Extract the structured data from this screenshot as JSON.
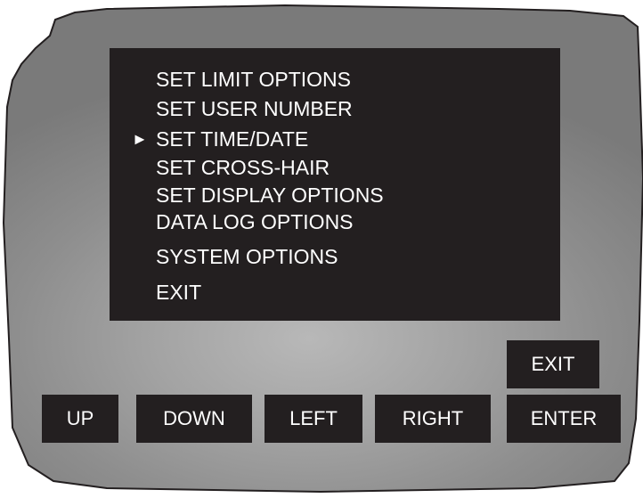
{
  "menu": {
    "items": [
      {
        "label": "SET LIMIT OPTIONS"
      },
      {
        "label": "SET USER NUMBER"
      },
      {
        "label": "SET TIME/DATE",
        "selected": true
      },
      {
        "label": "SET CROSS-HAIR"
      },
      {
        "label": "SET DISPLAY OPTIONS"
      },
      {
        "label": "DATA LOG OPTIONS"
      },
      {
        "label": "SYSTEM OPTIONS"
      },
      {
        "label": "EXIT"
      }
    ],
    "cursor_glyph": "►"
  },
  "buttons": {
    "up": "UP",
    "down": "DOWN",
    "left": "LEFT",
    "right": "RIGHT",
    "enter": "ENTER",
    "exit": "EXIT"
  },
  "colors": {
    "screen": "#231f20",
    "text": "#ffffff",
    "bezel": "#9a9a9a"
  }
}
